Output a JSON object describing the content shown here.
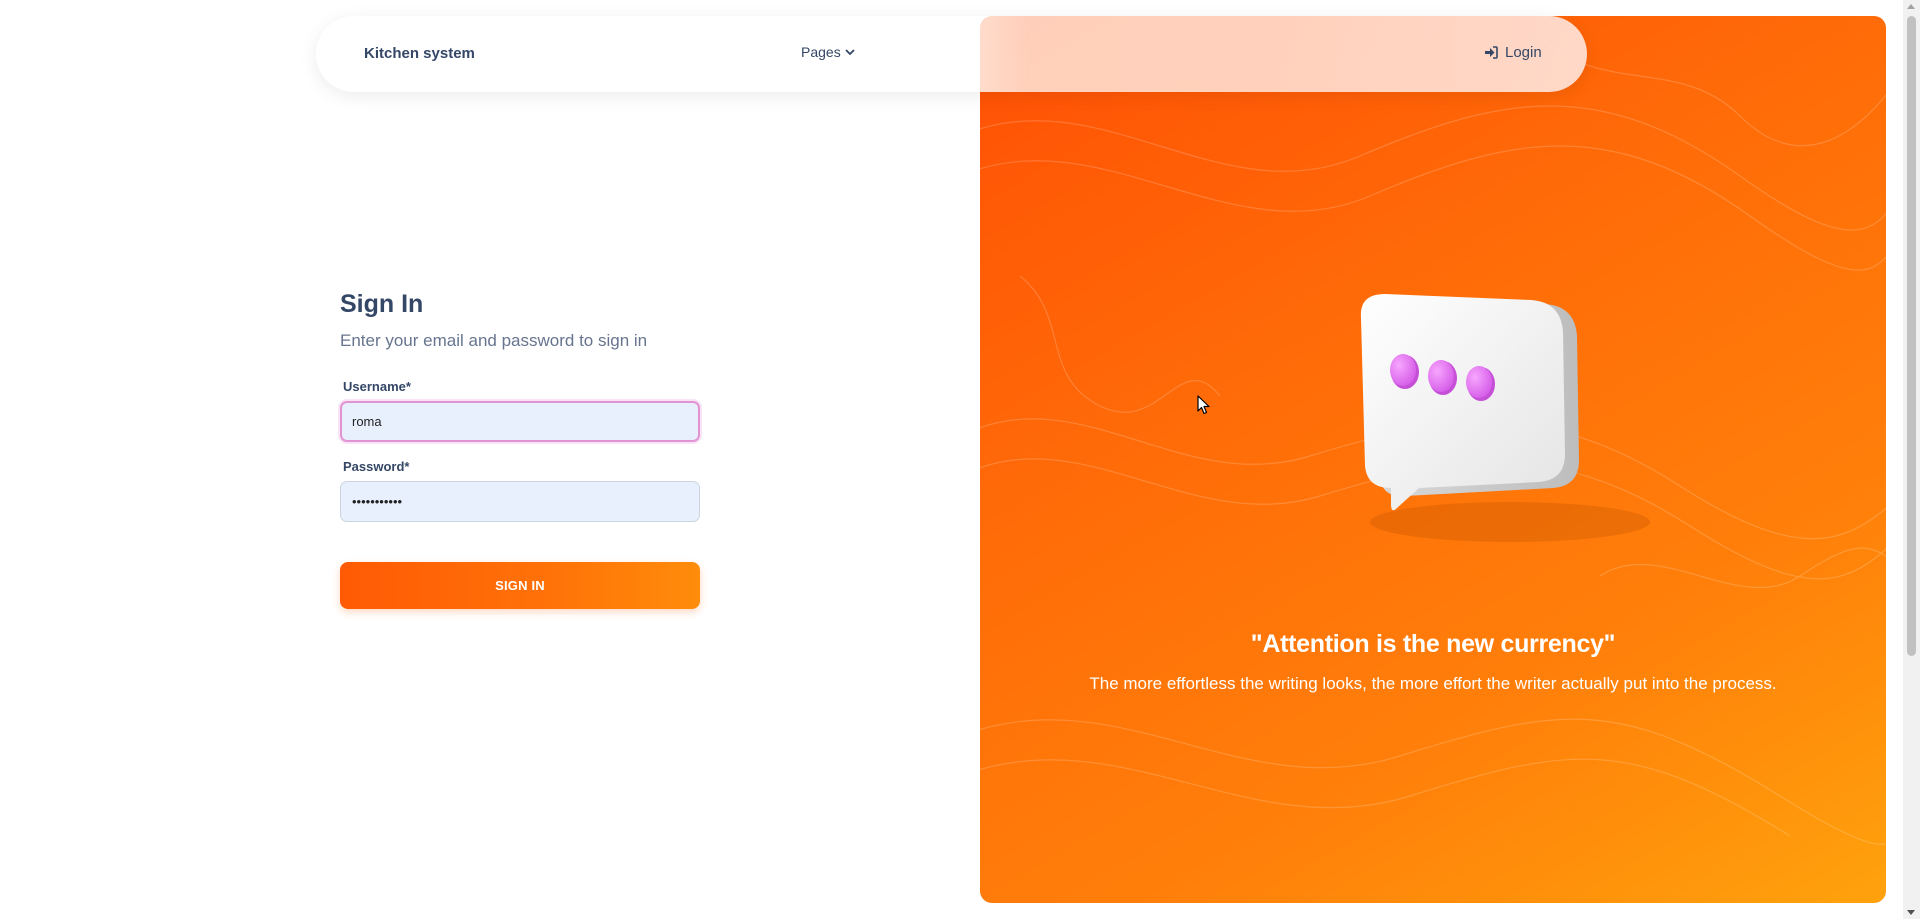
{
  "navbar": {
    "brand": "Kitchen system",
    "pages_label": "Pages",
    "login_label": "Login"
  },
  "signin": {
    "title": "Sign In",
    "subtitle": "Enter your email and password to sign in",
    "username_label": "Username*",
    "username_value": "roma",
    "password_label": "Password*",
    "password_value": "roma1234567",
    "button_label": "SIGN IN"
  },
  "hero": {
    "quote": "\"Attention is the new currency\"",
    "text": "The more effortless the writing looks, the more effort the writer actually put into the process."
  },
  "icons": {
    "pages_chevron": "chevron-down-icon",
    "login": "sign-in-icon",
    "illustration": "chat-bubble-icon",
    "cursor": "mouse-cursor-icon"
  },
  "colors": {
    "accent": "#ff6a08",
    "accent_light": "#ffa20c",
    "text_dark": "#344767",
    "text_muted": "#67748e",
    "input_bg": "#e8f0fe",
    "focus_border": "#e293d3",
    "bubble_dots": "#e879f9"
  }
}
